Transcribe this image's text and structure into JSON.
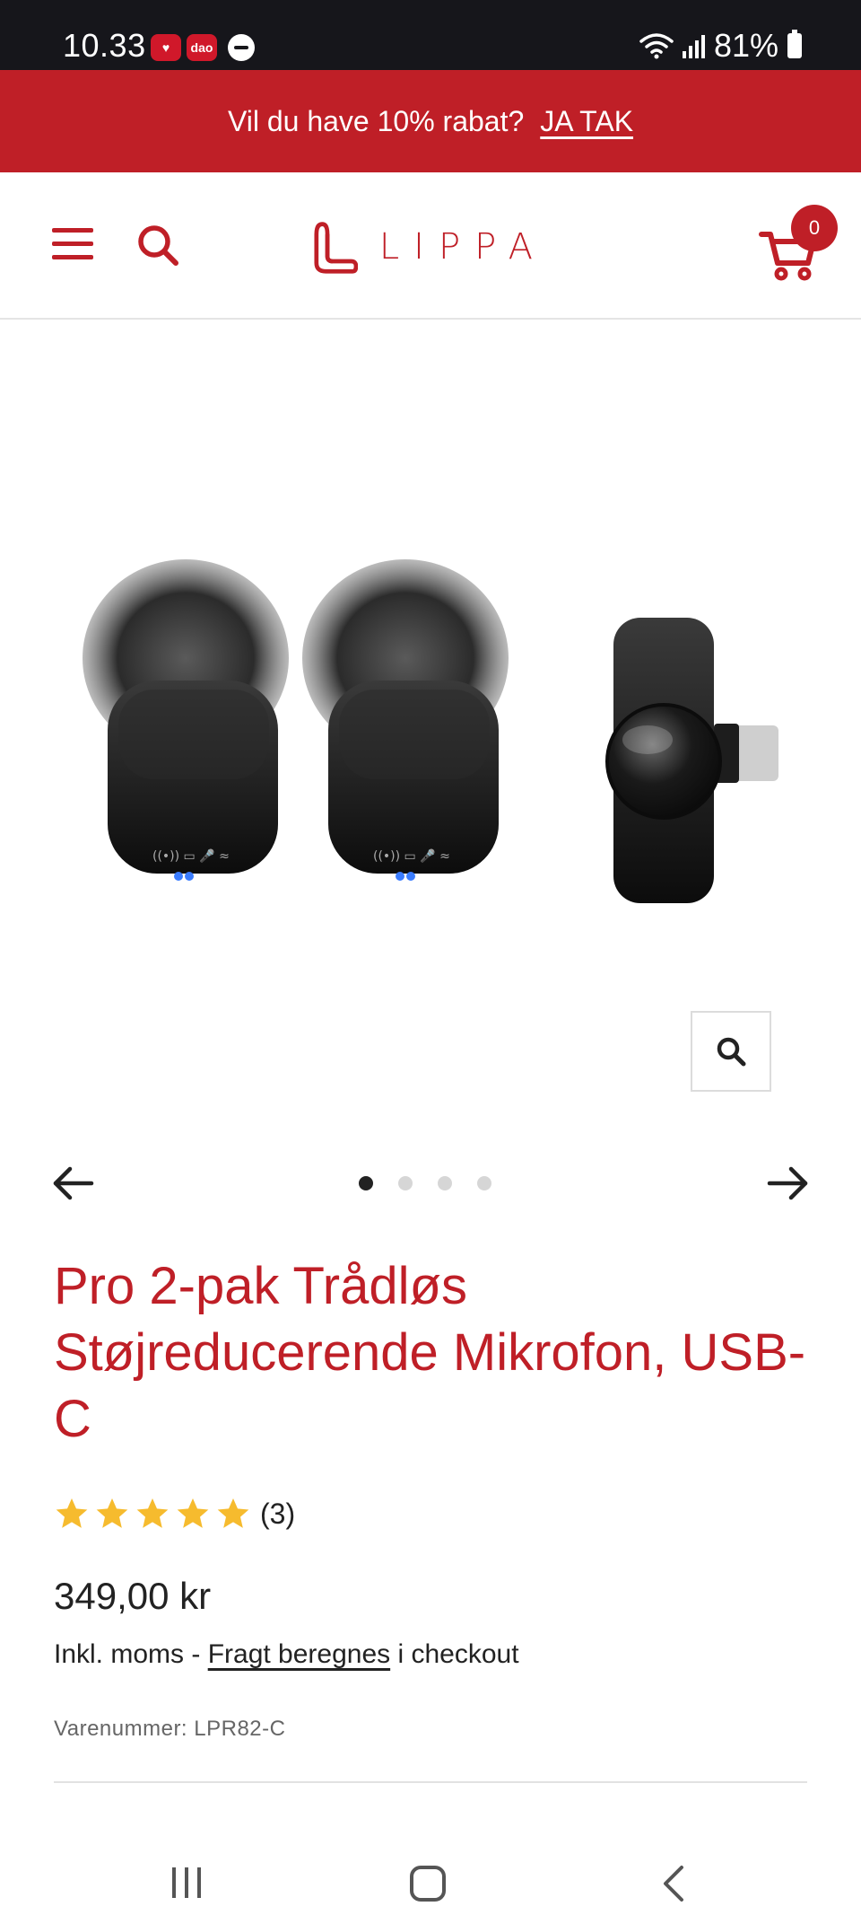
{
  "status_bar": {
    "time": "10.33",
    "notification_1": "♥",
    "notification_2": "dao",
    "battery": "81%"
  },
  "promo": {
    "text": "Vil du have 10% rabat?",
    "link": "JA TAK"
  },
  "header": {
    "logo_text": "LIPPA",
    "cart_count": "0"
  },
  "gallery": {
    "image_alt": "Pro 2-pak Trådløs Støjreducerende Mikrofon, USB-C",
    "slide_count": 4,
    "active_slide": 1
  },
  "product": {
    "title": "Pro 2-pak Trådløs Støjreducerende Mikrofon, USB-C",
    "rating": 5,
    "review_count": "(3)",
    "price": "349,00 kr",
    "tax_prefix": "Inkl. moms - ",
    "shipping_link": "Fragt beregnes",
    "tax_suffix": " i checkout",
    "sku": "Varenummer: LPR82-C"
  },
  "colors": {
    "brand_red": "#bf1f27",
    "star_gold": "#f6bb2e"
  }
}
